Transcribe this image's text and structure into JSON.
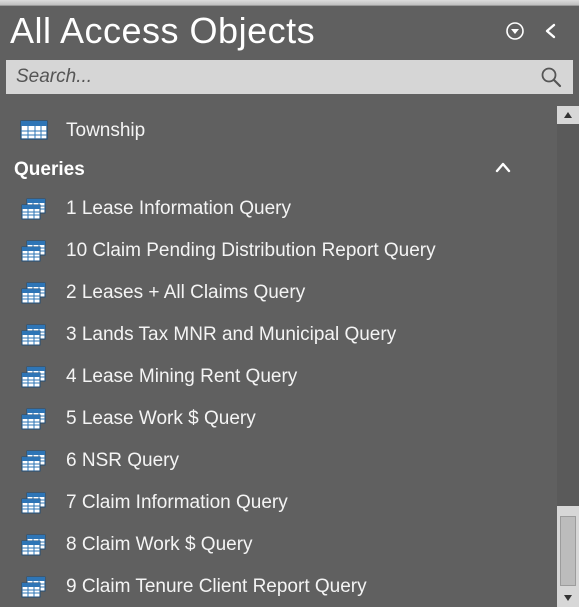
{
  "header": {
    "title": "All Access Objects"
  },
  "search": {
    "placeholder": "Search..."
  },
  "tables": {
    "items": [
      {
        "label": "Township"
      }
    ]
  },
  "queries": {
    "group_label": "Queries",
    "items": [
      {
        "label": "1 Lease Information Query"
      },
      {
        "label": "10 Claim Pending Distribution Report Query"
      },
      {
        "label": "2 Leases + All Claims Query"
      },
      {
        "label": "3 Lands Tax MNR and Municipal Query"
      },
      {
        "label": "4 Lease Mining Rent Query"
      },
      {
        "label": "5 Lease Work $ Query"
      },
      {
        "label": "6 NSR Query"
      },
      {
        "label": "7 Claim Information Query"
      },
      {
        "label": "8 Claim Work $ Query"
      },
      {
        "label": "9 Claim Tenure Client Report Query"
      }
    ]
  }
}
